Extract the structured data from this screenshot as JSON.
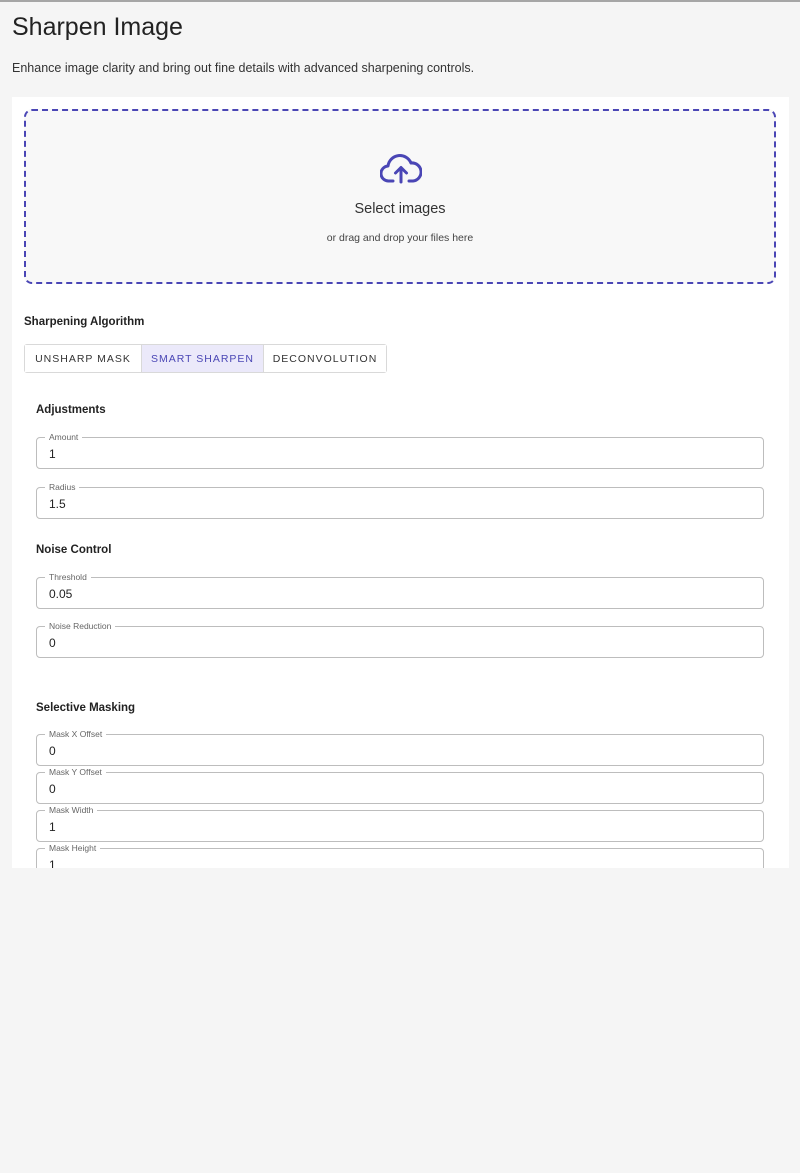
{
  "page": {
    "title": "Sharpen Image",
    "description": "Enhance image clarity and bring out fine details with advanced sharpening controls."
  },
  "upload": {
    "icon": "cloud-upload-icon",
    "title": "Select images",
    "subtitle": "or drag and drop your files here",
    "accent_color": "#4a46b5"
  },
  "algorithm": {
    "label": "Sharpening Algorithm",
    "tabs": [
      {
        "label": "UNSHARP MASK",
        "active": false
      },
      {
        "label": "SMART SHARPEN",
        "active": true
      },
      {
        "label": "DECONVOLUTION",
        "active": false
      }
    ]
  },
  "adjustments": {
    "label": "Adjustments",
    "amount": {
      "label": "Amount",
      "value": "1"
    },
    "radius": {
      "label": "Radius",
      "value": "1.5"
    }
  },
  "noise": {
    "label": "Noise Control",
    "threshold": {
      "label": "Threshold",
      "value": "0.05"
    },
    "reduction": {
      "label": "Noise Reduction",
      "value": "0"
    }
  },
  "masking": {
    "label": "Selective Masking",
    "x_offset": {
      "label": "Mask X Offset",
      "value": "0"
    },
    "y_offset": {
      "label": "Mask Y Offset",
      "value": "0"
    },
    "width": {
      "label": "Mask Width",
      "value": "1"
    },
    "height": {
      "label": "Mask Height",
      "value": "1"
    }
  }
}
